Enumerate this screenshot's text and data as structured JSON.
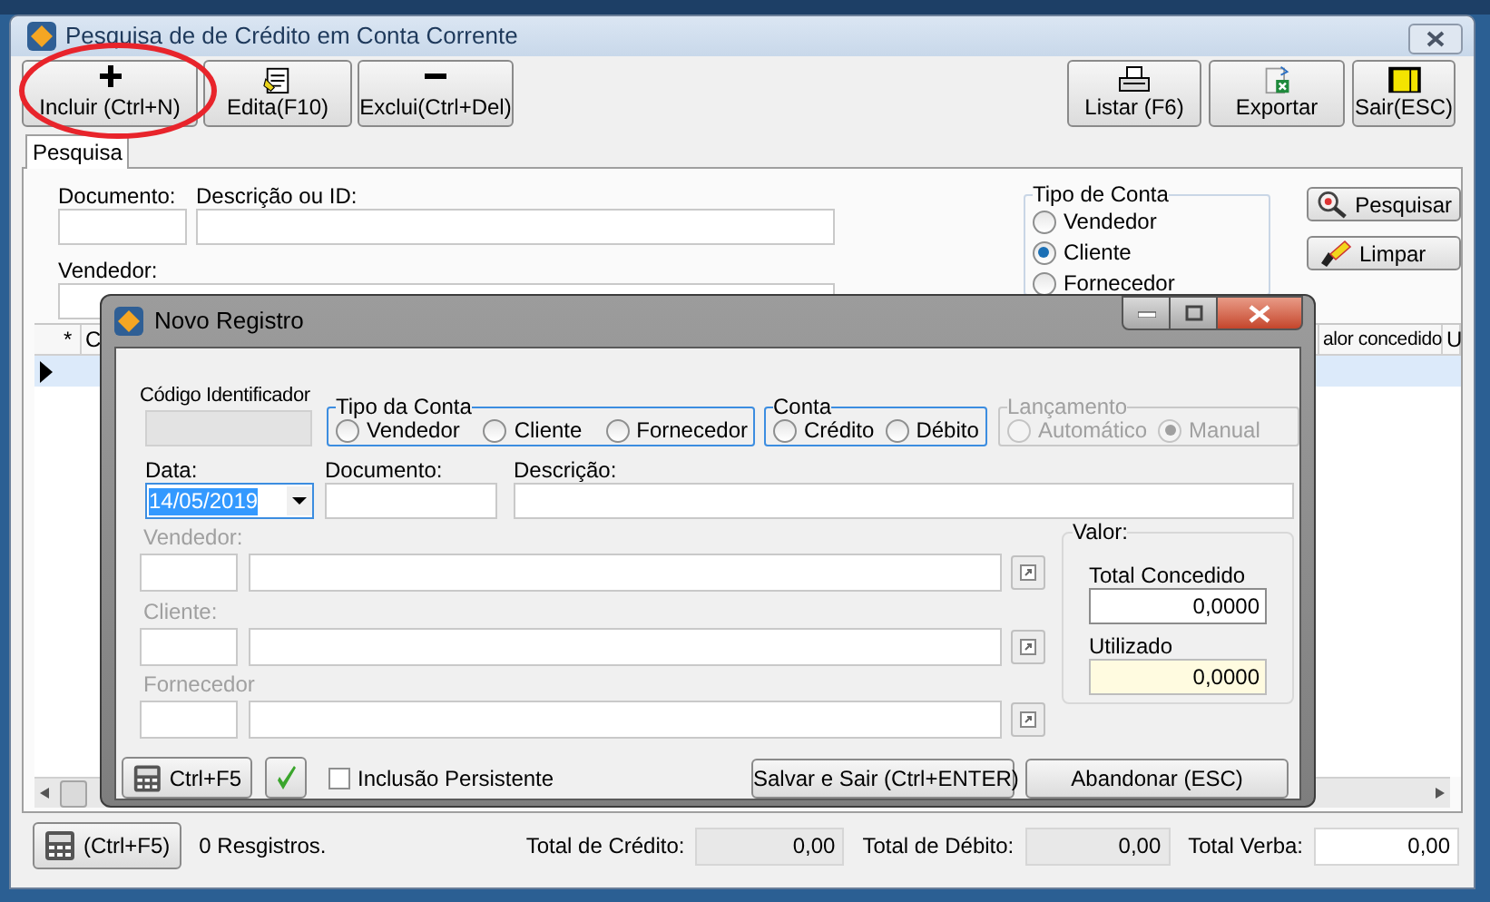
{
  "window": {
    "title": "Pesquisa de  de Crédito em Conta Corrente"
  },
  "toolbar_left": [
    {
      "label": "Incluir (Ctrl+N)",
      "kind": "plus"
    },
    {
      "label": "Edita(F10)",
      "kind": "edit"
    },
    {
      "label": "Exclui(Ctrl+Del)",
      "kind": "minus"
    }
  ],
  "toolbar_right": [
    {
      "label": "Listar (F6)",
      "kind": "print"
    },
    {
      "label": "Exportar",
      "kind": "export"
    },
    {
      "label": "Sair(ESC)",
      "kind": "exit"
    }
  ],
  "tabs": [
    {
      "label": "Pesquisa",
      "selected": true
    }
  ],
  "search_form": {
    "document_label": "Documento:",
    "description_label": "Descrição ou ID:",
    "seller_label": "Vendedor:"
  },
  "account_type": {
    "title": "Tipo de Conta",
    "options": [
      {
        "label": "Vendedor",
        "selected": false
      },
      {
        "label": "Cliente",
        "selected": true
      },
      {
        "label": "Fornecedor",
        "selected": false
      }
    ]
  },
  "search_buttons": [
    {
      "label": "Pesquisar",
      "kind": "search"
    },
    {
      "label": "Limpar",
      "kind": "clear"
    }
  ],
  "grid": {
    "columns": [
      "*",
      "C",
      "alor concedido",
      "U"
    ]
  },
  "dialog": {
    "title": "Novo Registro",
    "id_label": "Código Identificador",
    "account_type": {
      "title": "Tipo da Conta",
      "options": [
        {
          "label": "Vendedor",
          "selected": false
        },
        {
          "label": "Cliente",
          "selected": false
        },
        {
          "label": "Fornecedor",
          "selected": false
        }
      ]
    },
    "account": {
      "title": "Conta",
      "options": [
        {
          "label": "Crédito",
          "selected": false
        },
        {
          "label": "Débito",
          "selected": false
        }
      ]
    },
    "entry": {
      "title": "Lançamento",
      "disabled": true,
      "options": [
        {
          "label": "Automático",
          "selected": false
        },
        {
          "label": "Manual",
          "selected": true
        }
      ]
    },
    "date": {
      "label": "Data:",
      "value": "14/05/2019"
    },
    "document_label": "Documento:",
    "description_label": "Descrição:",
    "parties": [
      {
        "label": "Vendedor:",
        "disabled": true
      },
      {
        "label": "Cliente:",
        "disabled": true
      },
      {
        "label": "Fornecedor",
        "disabled": true
      }
    ],
    "value_group": {
      "title": "Valor:",
      "fields": [
        {
          "label": "Total Concedido",
          "value": "0,0000",
          "kind": "normal"
        },
        {
          "label": "Utilizado",
          "value": "0,0000",
          "kind": "readonly"
        }
      ]
    },
    "calc_button": "Ctrl+F5",
    "persistent": {
      "label": "Inclusão Persistente",
      "checked": false
    },
    "buttons": [
      "Salvar e Sair (Ctrl+ENTER)",
      "Abandonar (ESC)"
    ]
  },
  "footer": {
    "calc_button": "(Ctrl+F5)",
    "count": "0 Resgistros.",
    "totals": [
      {
        "label": "Total de Crédito:",
        "value": "0,00",
        "kind": "readonly"
      },
      {
        "label": "Total de Débito:",
        "value": "0,00",
        "kind": "readonly"
      },
      {
        "label": "Total Verba:",
        "value": "0,00",
        "kind": "normal"
      }
    ]
  }
}
